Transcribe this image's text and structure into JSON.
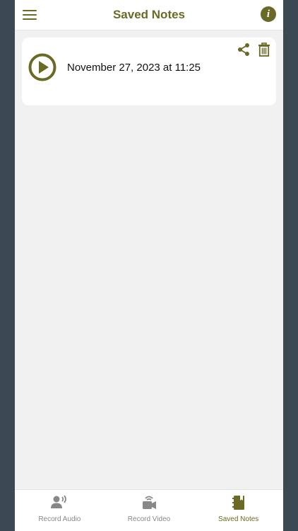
{
  "header": {
    "title": "Saved Notes",
    "menu_icon": "hamburger-menu-icon",
    "info_icon": "info-icon"
  },
  "notes": [
    {
      "date": "November 27, 2023 at 11:25",
      "play_icon": "play-icon",
      "share_icon": "share-icon",
      "delete_icon": "trash-icon"
    }
  ],
  "tabs": [
    {
      "label": "Record Audio",
      "icon": "speaking-person-icon",
      "active": false
    },
    {
      "label": "Record Video",
      "icon": "video-camera-icon",
      "active": false
    },
    {
      "label": "Saved Notes",
      "icon": "notebook-icon",
      "active": true
    }
  ],
  "colors": {
    "accent": "#6a6a26",
    "inactive": "#888888",
    "background": "#f1f1f1",
    "outer_background": "#3b4a52"
  }
}
